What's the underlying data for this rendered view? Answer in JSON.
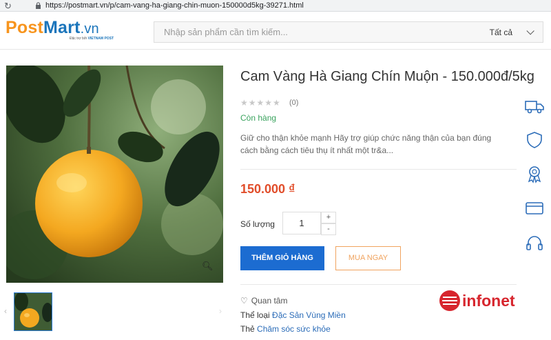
{
  "browser": {
    "url": "https://postmart.vn/p/cam-vang-ha-giang-chin-muon-150000d5kg-39271.html",
    "nav_glyph": "⟵ ⟳"
  },
  "header": {
    "logo_post": "Post",
    "logo_mart": "Mart",
    "logo_vn": ".vn",
    "logo_tag_prefix": "Đặc trợ bởi",
    "logo_tag_brand": "VIETNAM POST",
    "search_placeholder": "Nhập sản phẩm cần tìm kiếm...",
    "category": "Tất cả"
  },
  "product": {
    "title": "Cam Vàng Hà Giang Chín Muộn - 150.000đ/5kg",
    "stars": "★★★★★",
    "rating_count": "(0)",
    "stock": "Còn hàng",
    "description": "Giữ cho thận khỏe mạnh Hãy trợ giúp chức năng thận của bạn đúng cách bằng cách tiêu thụ ít nhất một tr&a...",
    "price": "150.000 ₫",
    "quantity_label": "Số lượng",
    "quantity": "1",
    "plus": "+",
    "minus": "-",
    "add_to_cart": "THÊM GIỎ HÀNG",
    "buy_now": "MUA NGAY",
    "favorite": "Quan tâm",
    "category_label": "Thể loại",
    "category_value": "Đặc Sản Vùng Miền",
    "tag_label": "Thẻ",
    "tag_value": "Chăm sóc sức khỏe"
  },
  "watermark": "infonet",
  "colors": {
    "brand_orange": "#f7941d",
    "brand_blue": "#1b75bb",
    "price": "#e14d2a",
    "stock": "#3aa35e",
    "button": "#1c6cd1",
    "icon": "#2b6cb8"
  },
  "side_icons": [
    "truck-icon",
    "shield-icon",
    "award-icon",
    "credit-card-icon",
    "headphones-icon"
  ]
}
